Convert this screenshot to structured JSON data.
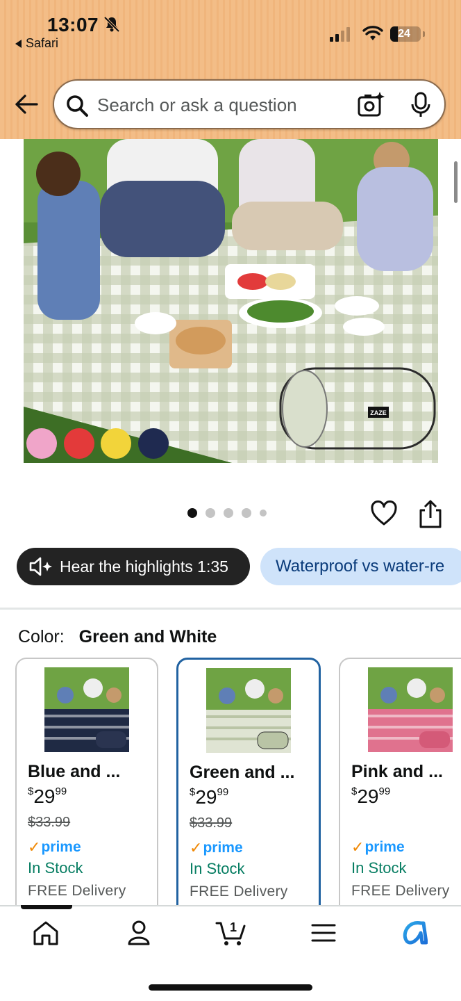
{
  "status_bar": {
    "time": "13:07",
    "back_app": "Safari",
    "battery": "24",
    "icons": [
      "bell-slash-icon",
      "cellular-signal-icon",
      "wifi-icon",
      "battery-icon"
    ]
  },
  "header": {
    "search_placeholder": "Search or ask a question",
    "icons": [
      "back-arrow-icon",
      "search-icon",
      "camera-lens-icon",
      "microphone-icon"
    ]
  },
  "gallery": {
    "image_label": "ZAZE",
    "page_count": 5,
    "active_page": 1
  },
  "actions": {
    "hear_highlights": "Hear the highlights 1:35",
    "comparison_chip": "Waterproof vs water-re"
  },
  "color": {
    "label": "Color:",
    "selected": "Green and White"
  },
  "variants": [
    {
      "name": "Blue and ...",
      "currency": "$",
      "price_whole": "29",
      "price_fraction": "99",
      "list_price": "$33.99",
      "prime": "prime",
      "stock": "In Stock",
      "delivery": "FREE Delivery",
      "color": "#1f2a44"
    },
    {
      "name": "Green and ...",
      "currency": "$",
      "price_whole": "29",
      "price_fraction": "99",
      "list_price": "$33.99",
      "prime": "prime",
      "stock": "In Stock",
      "delivery": "FREE Delivery",
      "color": "#b9c4a5"
    },
    {
      "name": "Pink and ...",
      "currency": "$",
      "price_whole": "29",
      "price_fraction": "99",
      "prime": "prime",
      "stock": "In Stock",
      "delivery": "FREE Delivery",
      "color": "#e0728e"
    }
  ],
  "bottom_nav": {
    "items": [
      "home-icon",
      "account-icon",
      "cart-icon",
      "menu-icon",
      "rufus-icon"
    ],
    "cart_count": "1"
  },
  "colors": {
    "header_bg": "#f3bd87",
    "selected_border": "#2162a1",
    "prime_blue": "#1a98ff",
    "in_stock_green": "#067d62",
    "chip_bg": "#cfe3fa"
  }
}
